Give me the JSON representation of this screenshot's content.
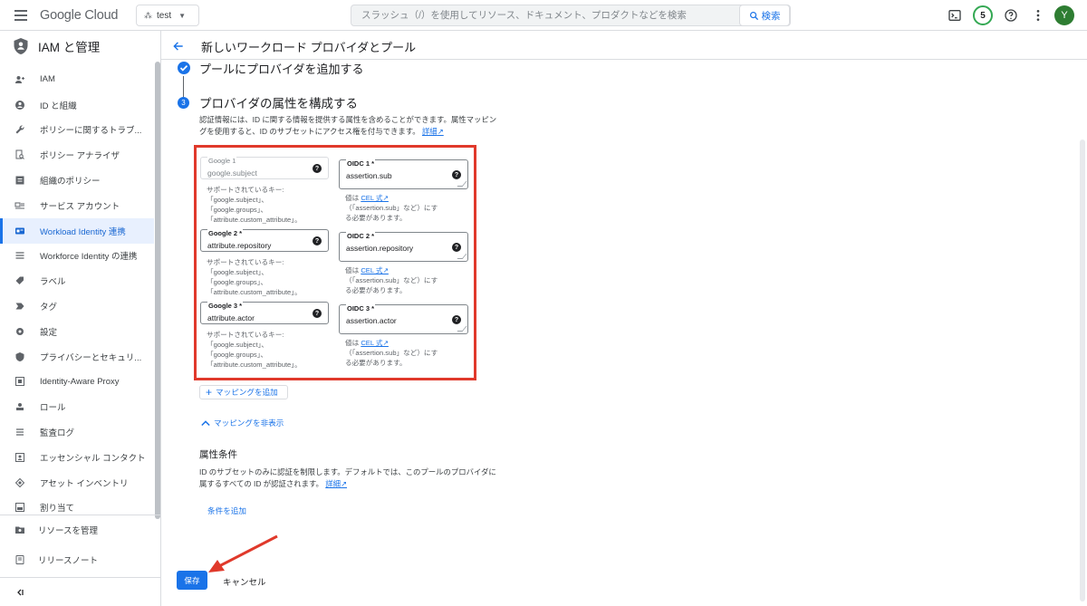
{
  "topbar": {
    "logo_google": "Google",
    "logo_cloud": "Cloud",
    "project": "test",
    "search_placeholder": "スラッシュ（/）を使用してリソース、ドキュメント、プロダクトなどを検索",
    "search_button": "検索",
    "notifications_count": "5",
    "avatar_initial": "Y"
  },
  "sidebar": {
    "title": "IAM と管理",
    "items": [
      {
        "label": "IAM",
        "icon": "person-add-icon"
      },
      {
        "label": "ID と組織",
        "icon": "account-circle-icon"
      },
      {
        "label": "ポリシーに関するトラブ...",
        "icon": "wrench-icon"
      },
      {
        "label": "ポリシー アナライザ",
        "icon": "document-search-icon"
      },
      {
        "label": "組織のポリシー",
        "icon": "list-box-icon"
      },
      {
        "label": "サービス アカウント",
        "icon": "service-account-icon"
      },
      {
        "label": "Workload Identity 連携",
        "icon": "id-card-icon"
      },
      {
        "label": "Workforce Identity の連携",
        "icon": "list-icon"
      },
      {
        "label": "ラベル",
        "icon": "label-icon"
      },
      {
        "label": "タグ",
        "icon": "tag-icon"
      },
      {
        "label": "設定",
        "icon": "gear-icon"
      },
      {
        "label": "プライバシーとセキュリ...",
        "icon": "shield-icon"
      },
      {
        "label": "Identity-Aware Proxy",
        "icon": "proxy-icon"
      },
      {
        "label": "ロール",
        "icon": "roles-icon"
      },
      {
        "label": "監査ログ",
        "icon": "audit-log-icon"
      },
      {
        "label": "エッセンシャル コンタクト",
        "icon": "contact-icon"
      },
      {
        "label": "アセット インベントリ",
        "icon": "diamond-icon"
      },
      {
        "label": "割り当て",
        "icon": "quota-icon"
      }
    ],
    "manage_resources": "リソースを管理",
    "release_notes": "リリースノート"
  },
  "page": {
    "title": "新しいワークロード プロバイダとプール",
    "step1_title": "プールにプロバイダを追加する",
    "step2_number": "3",
    "step2_title": "プロバイダの属性を構成する",
    "step2_desc": "認証情報には、ID に関する情報を提供する属性を含めることができます。属性マッピングを使用すると、ID のサブセットにアクセス権を付与できます。",
    "details_link": "詳細"
  },
  "mappings": [
    {
      "google_label": "Google 1",
      "google_value": "google.subject",
      "oidc_label": "OIDC 1 *",
      "oidc_value": "assertion.sub"
    },
    {
      "google_label": "Google 2 *",
      "google_value": "attribute.repository",
      "oidc_label": "OIDC 2 *",
      "oidc_value": "assertion.repository"
    },
    {
      "google_label": "Google 3 *",
      "google_value": "attribute.actor",
      "oidc_label": "OIDC 3 *",
      "oidc_value": "assertion.actor"
    }
  ],
  "hints": {
    "supported_keys": "サポートされているキー:\n「google.subject」、\n「google.groups」、\n「attribute.custom_attribute」。",
    "cel_prefix": "値は",
    "cel_link": "CEL 式",
    "cel_line2": "（「assertion.sub」など）にす",
    "cel_line3": "る必要があります。"
  },
  "actions": {
    "add_mapping": "マッピングを追加",
    "hide_mapping": "マッピングを非表示",
    "condition_title": "属性条件",
    "condition_desc": "ID のサブセットのみに認証を制限します。デフォルトでは、このプールのプロバイダに属するすべての ID が認証されます。",
    "condition_details": "詳細",
    "add_condition": "条件を追加",
    "save": "保存",
    "cancel": "キャンセル"
  },
  "colors": {
    "accent": "#1a73e8",
    "highlight_box": "#e0392b"
  }
}
